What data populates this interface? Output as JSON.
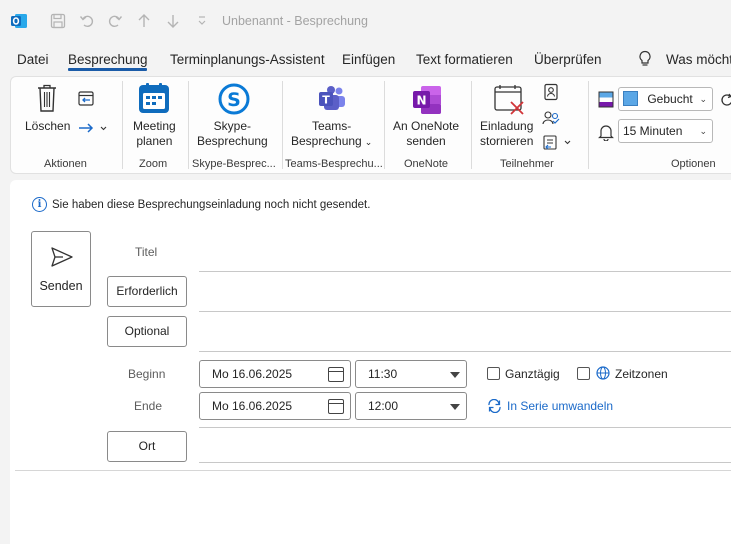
{
  "window": {
    "title": "Unbenannt  -  Besprechung"
  },
  "menu": {
    "items": [
      "Datei",
      "Besprechung",
      "Terminplanungs-Assistent",
      "Einfügen",
      "Text formatieren",
      "Überprüfen",
      "Was möcht"
    ],
    "active": "Besprechung"
  },
  "ribbon": {
    "delete_label": "Löschen",
    "meeting_plan_label": [
      "Meeting",
      "planen"
    ],
    "skype_label": [
      "Skype-",
      "Besprechung"
    ],
    "teams_label": [
      "Teams-",
      "Besprechung"
    ],
    "onenote_label": [
      "An OneNote",
      "senden"
    ],
    "cancel_invite_label": [
      "Einladung",
      "stornieren"
    ],
    "groups": [
      "Aktionen",
      "Zoom",
      "Skype-Besprec...",
      "Teams-Besprechu...",
      "OneNote",
      "Teilnehmer",
      "Optionen"
    ],
    "show_as_value": "Gebucht",
    "reminder_value": "15 Minuten",
    "show_as_color": "#5ba7e6"
  },
  "form": {
    "info_text": "Sie haben diese Besprechungseinladung noch nicht gesendet.",
    "send_label": "Senden",
    "title_label": "Titel",
    "required_label": "Erforderlich",
    "optional_label": "Optional",
    "start_label": "Beginn",
    "end_label": "Ende",
    "start_date": "Mo 16.06.2025",
    "start_time": "11:30",
    "end_date": "Mo 16.06.2025",
    "end_time": "12:00",
    "all_day_label": "Ganztägig",
    "timezones_label": "Zeitzonen",
    "recurrence_label": "In Serie umwandeln",
    "location_label": "Ort"
  },
  "colors": {
    "accent": "#1a5ba8",
    "link": "#1b6ac9",
    "outlook": "#0f6cbd",
    "teams": "#5b5fc7",
    "onenote": "#7719aa",
    "skype": "#0a7ad6"
  }
}
